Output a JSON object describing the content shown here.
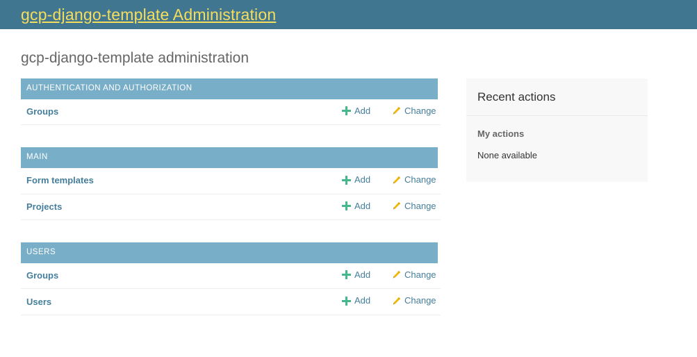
{
  "header": {
    "site_title": "gcp-django-template Administration",
    "background_color": "#417690",
    "title_color": "#f5dd5d"
  },
  "main": {
    "page_title": "gcp-django-template administration",
    "add_label": "Add",
    "change_label": "Change",
    "add_icon": "plus-icon",
    "change_icon": "pencil-icon",
    "accent_color": "#79aec8",
    "link_color": "#447e9b",
    "add_icon_color": "#44b78b",
    "change_icon_color": "#efb80b",
    "modules": [
      {
        "caption": "AUTHENTICATION AND AUTHORIZATION",
        "models": [
          {
            "name": "Groups",
            "add": "Add",
            "change": "Change"
          }
        ]
      },
      {
        "caption": "MAIN",
        "models": [
          {
            "name": "Form templates",
            "add": "Add",
            "change": "Change"
          },
          {
            "name": "Projects",
            "add": "Add",
            "change": "Change"
          }
        ]
      },
      {
        "caption": "USERS",
        "models": [
          {
            "name": "Groups",
            "add": "Add",
            "change": "Change"
          },
          {
            "name": "Users",
            "add": "Add",
            "change": "Change"
          }
        ]
      }
    ]
  },
  "sidebar": {
    "recent_actions_title": "Recent actions",
    "my_actions_title": "My actions",
    "none_available": "None available",
    "background_color": "#f8f8f8"
  }
}
